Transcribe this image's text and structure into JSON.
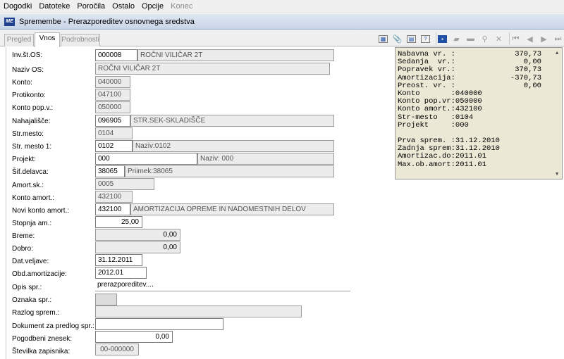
{
  "menu": [
    "Dogodki",
    "Datoteke",
    "Poročila",
    "Ostalo",
    "Opcije",
    "Konec"
  ],
  "window": {
    "title": "Spremembe - Prerazporeditev osnovnega sredstva"
  },
  "tabs": {
    "pregled": "Pregled",
    "vnos": "Vnos",
    "podrobnosti": "Podrobnosti"
  },
  "form": {
    "inv_os": {
      "label": "Inv.št.OS:",
      "value": "000008",
      "desc": "ROČNI VILIČAR 2T"
    },
    "naziv_os": {
      "label": "Naziv OS:",
      "value": "ROČNI VILIČAR 2T"
    },
    "konto": {
      "label": "Konto:",
      "value": "040000"
    },
    "protikonto": {
      "label": "Protikonto:",
      "value": "047100"
    },
    "konto_popv": {
      "label": "Konto pop.v.:",
      "value": "050000"
    },
    "nahajalisce": {
      "label": "Nahajališče:",
      "value": "096905",
      "desc": "STR.SEK-SKLADIŠČE"
    },
    "strmesto": {
      "label": "Str.mesto:",
      "value": "0104"
    },
    "strmesto1": {
      "label": "Str. mesto 1:",
      "value": "0102",
      "desc": "Naziv:0102"
    },
    "projekt": {
      "label": "Projekt:",
      "value": "000",
      "desc": "Naziv: 000"
    },
    "sif_delavca": {
      "label": "Šif.delavca:",
      "value": "38065",
      "desc": "Priimek:38065"
    },
    "amort_sk": {
      "label": "Amort.sk.:",
      "value": "0005"
    },
    "konto_amort": {
      "label": "Konto amort.:",
      "value": "432100"
    },
    "novi_konto_amort": {
      "label": "Novi konto amort.:",
      "value": "432100",
      "desc": "AMORTIZACIJA OPREME IN NADOMESTNIH DELOV"
    },
    "stopnja_am": {
      "label": "Stopnja am.:",
      "value": "25,00"
    },
    "breme": {
      "label": "Breme:",
      "value": "0,00"
    },
    "dobro": {
      "label": "Dobro:",
      "value": "0,00"
    },
    "dat_veljave": {
      "label": "Dat.veljave:",
      "value": "31.12.2011"
    },
    "obd_amortizacije": {
      "label": "Obd.amortizacije:",
      "value": "2012.01"
    },
    "opis_spr": {
      "label": "Opis spr.:",
      "value": "prerazporeditev...."
    },
    "oznaka_spr": {
      "label": "Oznaka spr.:",
      "value": ""
    },
    "razlog_sprem": {
      "label": "Razlog sprem.:",
      "value": ""
    },
    "dokument_predlog": {
      "label": "Dokument za predlog spr.:",
      "value": ""
    },
    "pogodbeni_znesek": {
      "label": "Pogodbeni znesek:",
      "value": "0,00"
    },
    "stevilka_zapisnika": {
      "label": "Številka zapisnika:",
      "value": "00-000000"
    }
  },
  "info_panel": {
    "values": [
      {
        "key": "Nabavna vr. :",
        "value": "370,73"
      },
      {
        "key": "Sedanja  vr.:",
        "value": "0,00"
      },
      {
        "key": "Popravek vr.:",
        "value": "370,73"
      },
      {
        "key": "Amortizacija:",
        "value": "-370,73"
      },
      {
        "key": "Preost. vr. :",
        "value": "0,00"
      }
    ],
    "accounts": [
      "Konto       :040000",
      "Konto pop.vr:050000",
      "Konto amort.:432100",
      "Str-mesto   :0104",
      "Projekt     :000"
    ],
    "dates": [
      "Prva sprem. :31.12.2010",
      "Zadnja sprem:31.12.2010",
      "Amortizac.do:2011.01",
      "Max.ob.amort:2011.01"
    ]
  }
}
